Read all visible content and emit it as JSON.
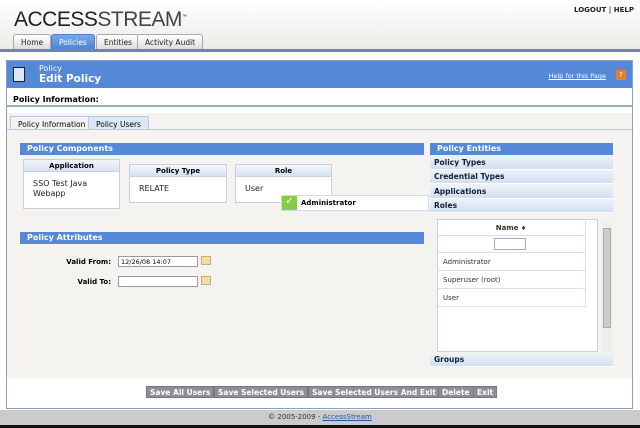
{
  "app": {
    "logo_bold": "ACCESS",
    "logo_light": "STREAM",
    "logout": "LOGOUT",
    "sep": "|",
    "help": "HELP"
  },
  "nav": {
    "tabs": [
      "Home",
      "Policies",
      "Entities",
      "Activity Audit"
    ],
    "active": "Policies"
  },
  "title": {
    "section": "Policy",
    "heading": "Edit Policy",
    "help_link": "Help for this Page",
    "help_icon": "?"
  },
  "policy_info_label": "Policy Information:",
  "tabs": [
    "Policy Information",
    "Policy Users"
  ],
  "components": {
    "header": "Policy Components",
    "application": {
      "label": "Application",
      "value": "SSO Test Java Webapp"
    },
    "policy_type": {
      "label": "Policy Type",
      "value": "RELATE"
    },
    "role": {
      "label": "Role",
      "value": "User"
    },
    "drag_item": "Administrator"
  },
  "attributes": {
    "header": "Policy Attributes",
    "valid_from_label": "Valid From:",
    "valid_from": "12/26/08 14:07",
    "valid_to_label": "Valid To:",
    "valid_to": ""
  },
  "entities": {
    "header": "Policy Entities",
    "sections": [
      "Policy Types",
      "Credential Types",
      "Applications",
      "Roles",
      "Groups"
    ],
    "grid": {
      "column": "Name",
      "sort_icon": "♦",
      "rows": [
        "Administrator",
        "Superuser (root)",
        "User"
      ]
    }
  },
  "buttons": [
    "Save All Users",
    "Save Selected Users",
    "Save Selected Users And Exit",
    "Delete",
    "Exit"
  ],
  "footer": {
    "copyright": "© 2005-2009 - ",
    "link": "AccessStream"
  }
}
